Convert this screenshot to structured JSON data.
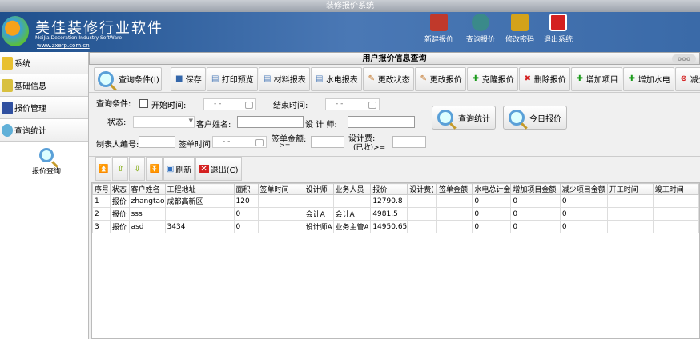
{
  "window": {
    "title": "装修报价系统"
  },
  "banner": {
    "brand": "美佳装修行业软件",
    "brand_en": "MeiJia Decoration Industry SoftWare",
    "url": "www.zxerp.com.cn",
    "buttons": [
      {
        "label": "新建报价",
        "icon": "new-quote-icon",
        "color": "#c0392b"
      },
      {
        "label": "查询报价",
        "icon": "search-quote-icon",
        "color": "#3a8a8a"
      },
      {
        "label": "修改密码",
        "icon": "keys-icon",
        "color": "#d4a21a"
      },
      {
        "label": "退出系统",
        "icon": "power-icon",
        "color": "#d42020"
      }
    ]
  },
  "sidebar": {
    "items": [
      {
        "label": "系统",
        "icon": "system-icon"
      },
      {
        "label": "基础信息",
        "icon": "base-info-icon"
      },
      {
        "label": "报价管理",
        "icon": "quote-manage-icon"
      },
      {
        "label": "查询统计",
        "icon": "search-stats-icon"
      }
    ],
    "sub_item": "报价查询"
  },
  "main": {
    "title": "用户报价信息查询",
    "toolbar": [
      {
        "label": "查询条件(I)",
        "icon": "search-icon"
      },
      {
        "label": "保存",
        "icon": "save-icon",
        "glyph": "■",
        "color": "#3366aa"
      },
      {
        "label": "打印预览",
        "icon": "print-preview-icon",
        "glyph": "▤",
        "color": "#4a7ab8"
      },
      {
        "label": "材料报表",
        "icon": "report-icon",
        "glyph": "▤",
        "color": "#4a7ab8"
      },
      {
        "label": "水电报表",
        "icon": "report-icon",
        "glyph": "▤",
        "color": "#4a7ab8"
      },
      {
        "label": "更改状态",
        "icon": "edit-icon",
        "glyph": "✎",
        "color": "#c07020"
      },
      {
        "label": "更改报价",
        "icon": "edit-icon",
        "glyph": "✎",
        "color": "#c07020"
      },
      {
        "label": "克隆报价",
        "icon": "plus-icon",
        "glyph": "✚",
        "color": "#1a9a1a"
      },
      {
        "label": "删除报价",
        "icon": "delete-icon",
        "glyph": "✖",
        "color": "#d42020"
      },
      {
        "label": "增加项目",
        "icon": "plus-icon",
        "glyph": "✚",
        "color": "#1a9a1a"
      },
      {
        "label": "增加水电",
        "icon": "plus-icon",
        "glyph": "✚",
        "color": "#1a9a1a"
      },
      {
        "label": "减少项目",
        "icon": "minus-circle-icon",
        "glyph": "⊗",
        "color": "#d42020"
      }
    ],
    "form": {
      "query_label": "查询条件:",
      "start_label": "开始时间:",
      "start_value": "- -",
      "end_label": "结束时间:",
      "end_value": "- -",
      "status_label": "状态:",
      "status_value": "",
      "customer_label": "客户姓名:",
      "customer_value": "",
      "designer_label": "设 计 师:",
      "designer_value": "",
      "maker_label": "制表人编号:",
      "maker_value": "",
      "sign_time_label": "签单时间",
      "sign_time_value": "- -",
      "sign_amount_label": "签单金额:",
      "sign_amount_sub": ">=",
      "sign_amount_value": "",
      "fee_label": "设计费:",
      "fee_sub": "(已收)>=",
      "fee_value": "",
      "stats_button": "查询统计",
      "today_button": "今日报价"
    },
    "nav": {
      "refresh": "刷新",
      "exit": "退出(C)"
    },
    "table": {
      "columns": [
        "序号",
        "状态",
        "客户姓名",
        "工程地址",
        "面积",
        "签单时间",
        "设计师",
        "业务人员",
        "报价",
        "设计费(",
        "签单金额",
        "水电总计金",
        "增加项目金额",
        "减少项目金额",
        "开工时间",
        "竣工时间"
      ],
      "rows": [
        [
          "1",
          "报价",
          "zhangtao",
          "成都高新区",
          "120",
          "",
          "",
          "",
          "12790.8",
          "",
          "",
          "0",
          "0",
          "0",
          "",
          ""
        ],
        [
          "2",
          "报价",
          "sss",
          "",
          "0",
          "",
          "会计A",
          "会计A",
          "4981.5",
          "",
          "",
          "0",
          "0",
          "0",
          "",
          ""
        ],
        [
          "3",
          "报价",
          "asd",
          "3434",
          "0",
          "",
          "设计师A",
          "业务主管A",
          "14950.65",
          "",
          "",
          "0",
          "0",
          "0",
          "",
          ""
        ]
      ]
    }
  }
}
